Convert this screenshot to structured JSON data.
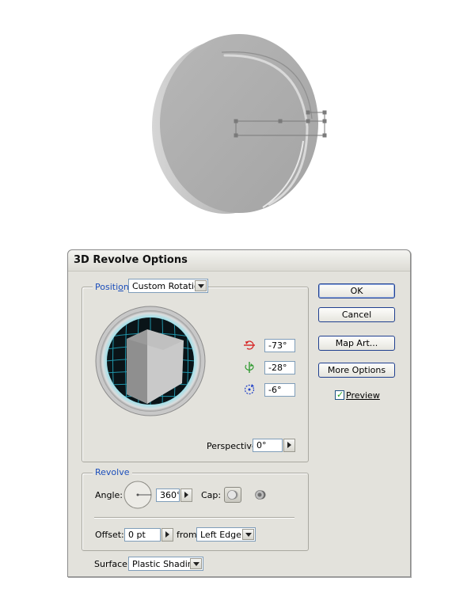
{
  "dialog": {
    "title": "3D Revolve Options",
    "position": {
      "label_pre": "Positi",
      "label_mnemonic": "o",
      "label_post": "n:",
      "selected": "Custom Rotation",
      "x_angle": "-73°",
      "y_angle": "-28°",
      "z_angle": "-6°",
      "perspective_label": "Perspective:",
      "perspective_value": "0°"
    },
    "buttons": {
      "ok": "OK",
      "cancel": "Cancel",
      "map_art": "Map Art...",
      "more_options": "More Options"
    },
    "preview": {
      "label": "Preview",
      "checked": true
    },
    "revolve": {
      "legend": "Revolve",
      "angle_label": "Angle:",
      "angle_value": "360°",
      "cap_label": "Cap:",
      "offset_label": "Offset:",
      "offset_value": "0 pt",
      "from_label": "from",
      "from_value": "Left Edge"
    },
    "surface": {
      "label": "Surface:",
      "value": "Plastic Shading"
    }
  },
  "colors": {
    "dialog_bg": "#e3e2dc",
    "legend_blue": "#1b4ebb",
    "x_axis_red": "#d62020",
    "y_axis_green": "#2e9a2e",
    "z_axis_blue": "#2040c8",
    "trackball_cyan": "#39b8c8"
  },
  "icons": {
    "x_rotate": "x-axis-rotate-icon",
    "y_rotate": "y-axis-rotate-icon",
    "z_rotate": "z-axis-rotate-icon",
    "cap_on": "cap-on-icon",
    "cap_off": "cap-off-icon"
  }
}
